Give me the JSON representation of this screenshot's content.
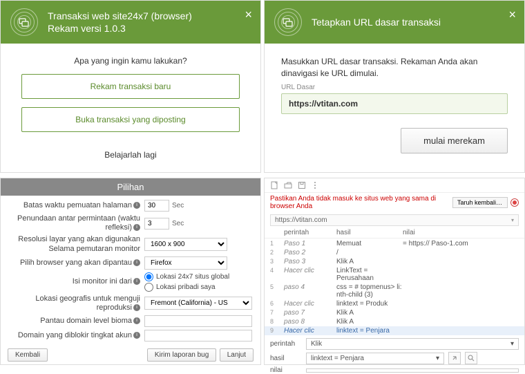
{
  "tl": {
    "title_line1": "Transaksi web site24x7 (browser)",
    "title_line2": "Rekam versi 1.0.3",
    "question": "Apa yang ingin kamu lakukan?",
    "btn_new": "Rekam transaksi baru",
    "btn_open": "Buka transaksi yang diposting",
    "learn": "Belajarlah lagi"
  },
  "tr": {
    "title": "Tetapkan URL dasar transaksi",
    "desc": "Masukkan URL dasar transaksi. Rekaman Anda akan dinavigasi ke URL dimulai.",
    "url_label": "URL Dasar",
    "url_value": "https://vtitan.com",
    "start": "mulai merekam"
  },
  "bl": {
    "header": "Pilihan",
    "rows": {
      "timeout_lbl": "Batas waktu pemuatan halaman",
      "timeout_val": "30",
      "think_lbl": "Penundaan antar permintaan (waktu refleksi)",
      "think_val": "3",
      "sec": "Sec",
      "res_lbl_1": "Resolusi layar yang akan digunakan",
      "res_lbl_2": "Selama pemutaran monitor",
      "res_val": "1600 x 900",
      "browser_lbl": "Pilih browser yang akan dipantau",
      "browser_val": "Firefox",
      "fill_lbl": "Isi monitor ini dari",
      "radio1": "Lokasi 24x7 situs global",
      "radio2": "Lokasi pribadi saya",
      "geo_lbl": "Lokasi geografis untuk menguji reproduksi",
      "geo_val": "Fremont (California) - US",
      "domain_lbl": "Pantau domain level bioma",
      "blocked_lbl": "Domain yang diblokir tingkat akun"
    },
    "back": "Kembali",
    "bug": "Kirim laporan bug",
    "next": "Lanjut"
  },
  "br": {
    "warning": "Pastikan Anda tidak masuk ke situs web yang sama di browser Anda",
    "revert": "Taruh kembali da...",
    "url": "https://vtitan.com",
    "cols": {
      "cmd": "perintah",
      "target": "hasil",
      "value": "nilai"
    },
    "rows": [
      {
        "n": "1",
        "cmd": "Paso 1",
        "target": "Memuat",
        "value": "= https:// Paso-1.com"
      },
      {
        "n": "2",
        "cmd": "Paso 2",
        "target": "/",
        "value": ""
      },
      {
        "n": "3",
        "cmd": "Paso 3",
        "target": "Klik A",
        "value": ""
      },
      {
        "n": "4",
        "cmd": "Hacer clic",
        "target": "LinkText = Perusahaan",
        "value": ""
      },
      {
        "n": "5",
        "cmd": "paso 4",
        "target": "css = # topmenus> li: nth-child (3)",
        "value": ""
      },
      {
        "n": "6",
        "cmd": "Hacer clic",
        "target": "linktext = Produk",
        "value": ""
      },
      {
        "n": "7",
        "cmd": "paso 7",
        "target": "Klik A",
        "value": ""
      },
      {
        "n": "8",
        "cmd": "paso 8",
        "target": "Klik A",
        "value": ""
      },
      {
        "n": "9",
        "cmd": "Hacer clic",
        "target": "linktext = Penjara",
        "value": ""
      }
    ],
    "edit": {
      "cmd_lbl": "perintah",
      "cmd_val": "Klik",
      "tgt_lbl": "hasil",
      "tgt_val": "linktext = Penjara",
      "val_lbl": "nilai"
    }
  }
}
